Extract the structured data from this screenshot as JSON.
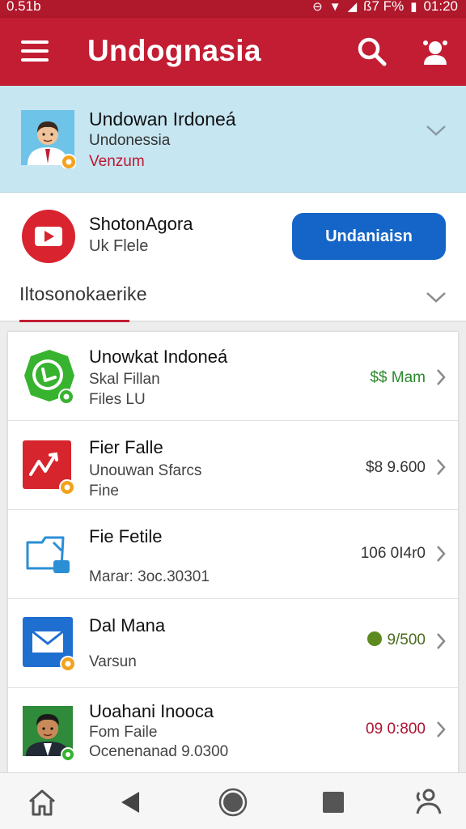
{
  "status_bar": {
    "time_left": "0.51b",
    "right_text": "ß7 F%",
    "time_right": "01:20"
  },
  "app_bar": {
    "title": "Undognasia"
  },
  "account": {
    "name": "Undowan Irdoneá",
    "subtitle": "Undonessia",
    "version": "Venzum"
  },
  "video_row": {
    "title": "ShotonAgora",
    "subtitle": "Uk Flele",
    "button_label": "Undaniaisn"
  },
  "section": {
    "label": "Iltosonokaerike"
  },
  "items": [
    {
      "title": "Unowkat Indoneá",
      "line2": "Skal Fillan",
      "line3": "Files LU",
      "price": "$$ Mam",
      "price_color": "#2c8a2c",
      "icon": "green-clock-app-icon"
    },
    {
      "title": "Fier Falle",
      "line2": "Unouwan Sfarcs",
      "line3": "Fine",
      "price": "$8 9.600",
      "price_color": "#333333",
      "icon": "red-chart-app-icon"
    },
    {
      "title": "Fie Fetile",
      "line2": "",
      "line3": "Marar: 3oc.30301",
      "price": "106 0I4r0",
      "price_color": "#333333",
      "icon": "folder-icon"
    },
    {
      "title": "Dal Mana",
      "line2": "",
      "line3": "Varsun",
      "price": "9/500",
      "price_color": "#4a6b1e",
      "icon": "mail-icon"
    },
    {
      "title": "Uoahani Inooca",
      "line2": "Fom Faile",
      "line3": "Ocenenanad 9.0300",
      "price": "09 0:800",
      "price_color": "#b01230",
      "icon": "person-avatar-icon"
    }
  ],
  "colors": {
    "primary": "#c21d33",
    "account_bg": "#c6e6f2",
    "button": "#1565c8"
  }
}
